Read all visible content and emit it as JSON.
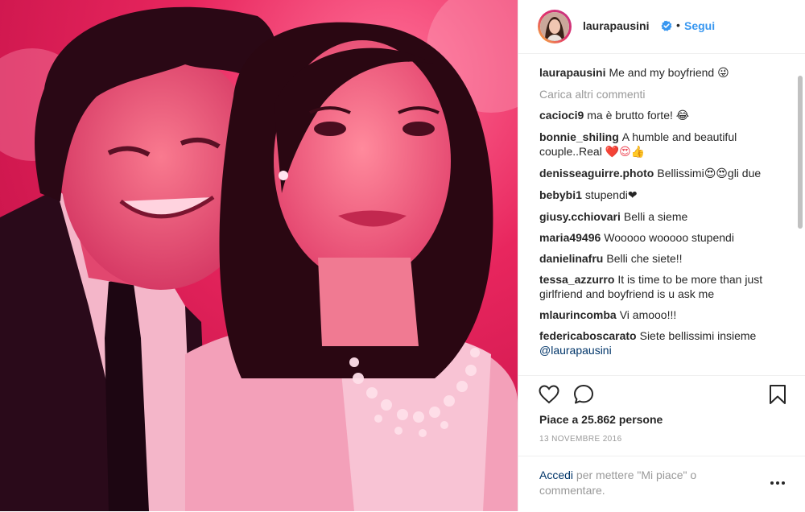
{
  "post": {
    "username": "laurapausini",
    "follow_label": "Segui",
    "dot": "•"
  },
  "caption": {
    "username": "laurapausini",
    "text": "Me and my boyfriend",
    "emoji": "😜"
  },
  "load_more_label": "Carica altri commenti",
  "comments": [
    {
      "user": "cacioci9",
      "text": "ma è brutto forte!",
      "emoji": "😂"
    },
    {
      "user": "bonnie_shiling",
      "text": "A humble and beautiful couple..Real",
      "emoji": "❤️😍👍"
    },
    {
      "user": "denisseaguirre.photo",
      "text": "Bellissimi",
      "emoji": "😍😍",
      "text2": "gli due"
    },
    {
      "user": "bebybi1",
      "text": "stupendi",
      "emoji": "❤"
    },
    {
      "user": "giusy.cchiovari",
      "text": "Belli a sieme"
    },
    {
      "user": "maria49496",
      "text": "Wooooo wooooo stupendi"
    },
    {
      "user": "danielinafru",
      "text": "Belli che siete!!"
    },
    {
      "user": "tessa_azzurro",
      "text": "It is time to be more than just girlfriend and boyfriend is u ask me"
    },
    {
      "user": "mlaurincomba",
      "text": "Vi amooo!!!"
    },
    {
      "user": "federicaboscarato",
      "text": "Siete bellissimi insieme",
      "mention": "@laurapausini"
    }
  ],
  "likes_text": "Piace a 25.862 persone",
  "date": "13 NOVEMBRE 2016",
  "login": {
    "link": "Accedi",
    "text": "per mettere \"Mi piace\" o commentare."
  },
  "icons": {
    "like": "heart-outline-icon",
    "comment": "speech-bubble-icon",
    "save": "bookmark-icon",
    "more": "ellipsis-icon",
    "verified": "verified-badge-icon"
  },
  "colors": {
    "link_blue": "#3897f0",
    "verified_blue": "#3897f0",
    "muted_gray": "#999999",
    "text": "#262626",
    "photo_tint": "#e0245e"
  }
}
